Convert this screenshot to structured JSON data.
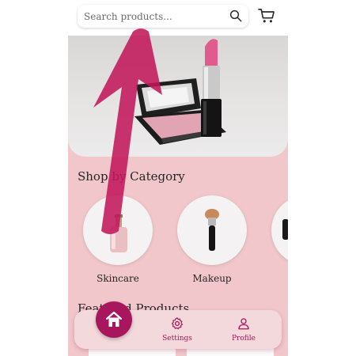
{
  "search": {
    "placeholder": "Search products..."
  },
  "sections": {
    "categories_title": "Shop by Category",
    "featured_title": "Featured Products"
  },
  "categories": [
    {
      "label": "Skincare"
    },
    {
      "label": "Makeup"
    }
  ],
  "nav": {
    "items": [
      {
        "label": "Settings"
      },
      {
        "label": "Profile"
      }
    ]
  },
  "icons": {
    "search": "search-icon",
    "cart": "cart-icon",
    "home": "home-icon",
    "settings": "gear-icon",
    "profile": "person-icon"
  },
  "colors": {
    "accent": "#a8175d",
    "background_pink": "#f1c7cb",
    "nav_background": "#f3d9dc",
    "overlay_arrow": "#c2185b"
  }
}
